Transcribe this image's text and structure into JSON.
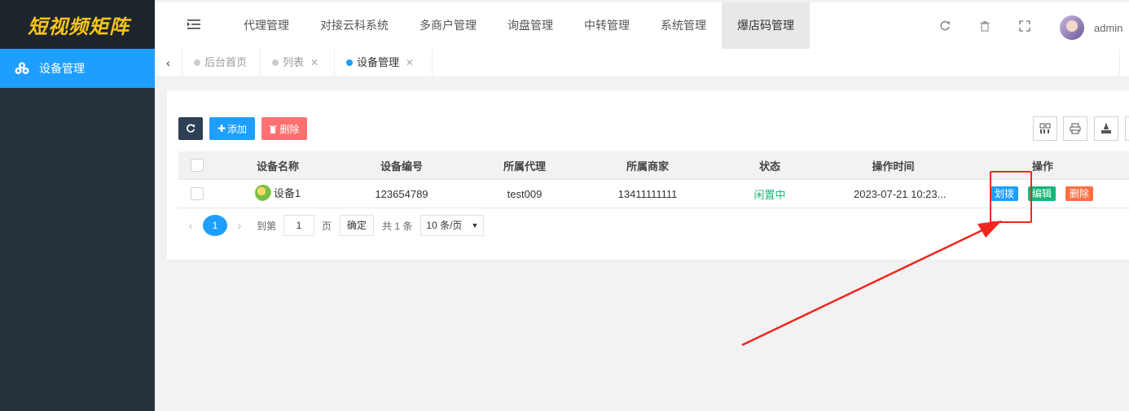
{
  "logo": "短视频矩阵",
  "sidebar": {
    "items": [
      {
        "label": "设备管理",
        "icon": "cubes-icon"
      }
    ]
  },
  "header": {
    "menu_toggle_icon": "menu-indent-icon",
    "nav": [
      "代理管理",
      "对接云科系统",
      "多商户管理",
      "询盘管理",
      "中转管理",
      "系统管理",
      "爆店码管理"
    ],
    "active_nav": "爆店码管理",
    "icons": [
      "refresh-icon",
      "trash-icon",
      "fullscreen-icon"
    ],
    "username": "admin"
  },
  "tabs": [
    {
      "label": "后台首页",
      "closable": false,
      "active": false
    },
    {
      "label": "列表",
      "closable": true,
      "active": false
    },
    {
      "label": "设备管理",
      "closable": true,
      "active": true
    }
  ],
  "toolbar": {
    "add_label": "添加",
    "delete_label": "删除"
  },
  "table": {
    "columns": [
      "设备名称",
      "设备编号",
      "所属代理",
      "所属商家",
      "状态",
      "操作时间",
      "操作"
    ],
    "rows": [
      {
        "name": "设备1",
        "code": "123654789",
        "agent": "test009",
        "merchant": "13411111111",
        "status": "闲置中",
        "time": "2023-07-21 10:23...",
        "actions": [
          "划拨",
          "编辑",
          "删除"
        ]
      }
    ]
  },
  "pagination": {
    "current": "1",
    "goto_label": "到第",
    "goto_value": "1",
    "page_label": "页",
    "confirm": "确定",
    "total": "共 1 条",
    "per_page": "10 条/页"
  },
  "colors": {
    "primary": "#1e9fff",
    "success": "#16b777",
    "danger": "#ff5722",
    "sidebar": "#28323d",
    "annotation": "#f0261e"
  }
}
